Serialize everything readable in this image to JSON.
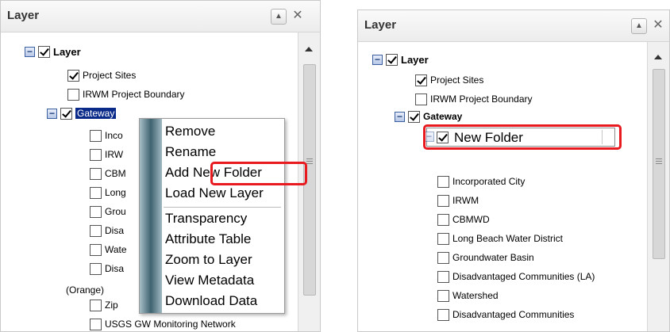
{
  "left": {
    "title": "Layer",
    "root": "Layer",
    "project_sites": "Project Sites",
    "irwm_boundary": "IRWM Project Boundary",
    "gateway": "Gateway",
    "children": [
      "Inco",
      "IRW",
      "CBM",
      "Long",
      "Grou",
      "Disa",
      "Wate",
      "Disa"
    ],
    "orange": "(Orange)",
    "zip": "Zip",
    "usgs": "USGS GW Monitoring Network",
    "menu": {
      "remove": "Remove",
      "rename": "Rename",
      "add_folder": "Add New Folder",
      "load_layer": "Load New Layer",
      "transparency": "Transparency",
      "attr_table": "Attribute Table",
      "zoom": "Zoom to Layer",
      "metadata": "View Metadata",
      "download": "Download Data"
    }
  },
  "right": {
    "title": "Layer",
    "root": "Layer",
    "project_sites": "Project Sites",
    "irwm_boundary": "IRWM Project Boundary",
    "gateway": "Gateway",
    "new_folder": "New Folder",
    "children": [
      "Incorporated City",
      "IRWM",
      "CBMWD",
      "Long Beach Water District",
      "Groundwater Basin",
      "Disadvantaged Communities (LA)",
      "Watershed",
      "Disadvantaged Communities"
    ]
  },
  "colors": {
    "highlight": "#e8191f",
    "selection": "#0a2a8a"
  },
  "icons": {
    "collapse": "minus-expander-icon",
    "check": "checkbox-icon",
    "minimize": "up-arrow-icon",
    "close": "close-x-icon"
  }
}
